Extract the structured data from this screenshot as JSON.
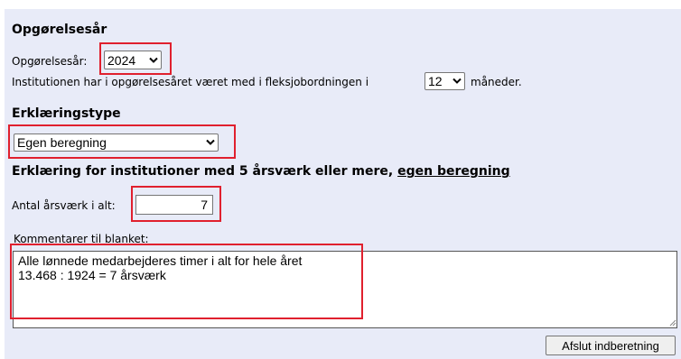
{
  "section1": {
    "heading": "Opgørelsesår",
    "year_label": "Opgørelsesår:",
    "year_value": "2024",
    "months_prefix": "Institutionen har i opgørelsesåret været med i fleksjobordningen i",
    "months_value": "12",
    "months_suffix": "måneder."
  },
  "section2": {
    "heading": "Erklæringstype",
    "type_value": "Egen beregning"
  },
  "section3": {
    "heading_prefix": "Erklæring for institutioner med 5 årsværk eller mere, ",
    "heading_link": "egen beregning",
    "aarsvaerk_label": "Antal årsværk i alt:",
    "aarsvaerk_value": "7",
    "comment_label": "Kommentarer til blanket:",
    "comment_text": "Alle lønnede medarbejderes timer i alt for hele året\n13.468 : 1924 = 7 årsværk"
  },
  "footer": {
    "submit_label": "Afslut indberetning"
  },
  "colors": {
    "panel_bg": "#e8ebf8",
    "highlight": "#e0202e"
  }
}
